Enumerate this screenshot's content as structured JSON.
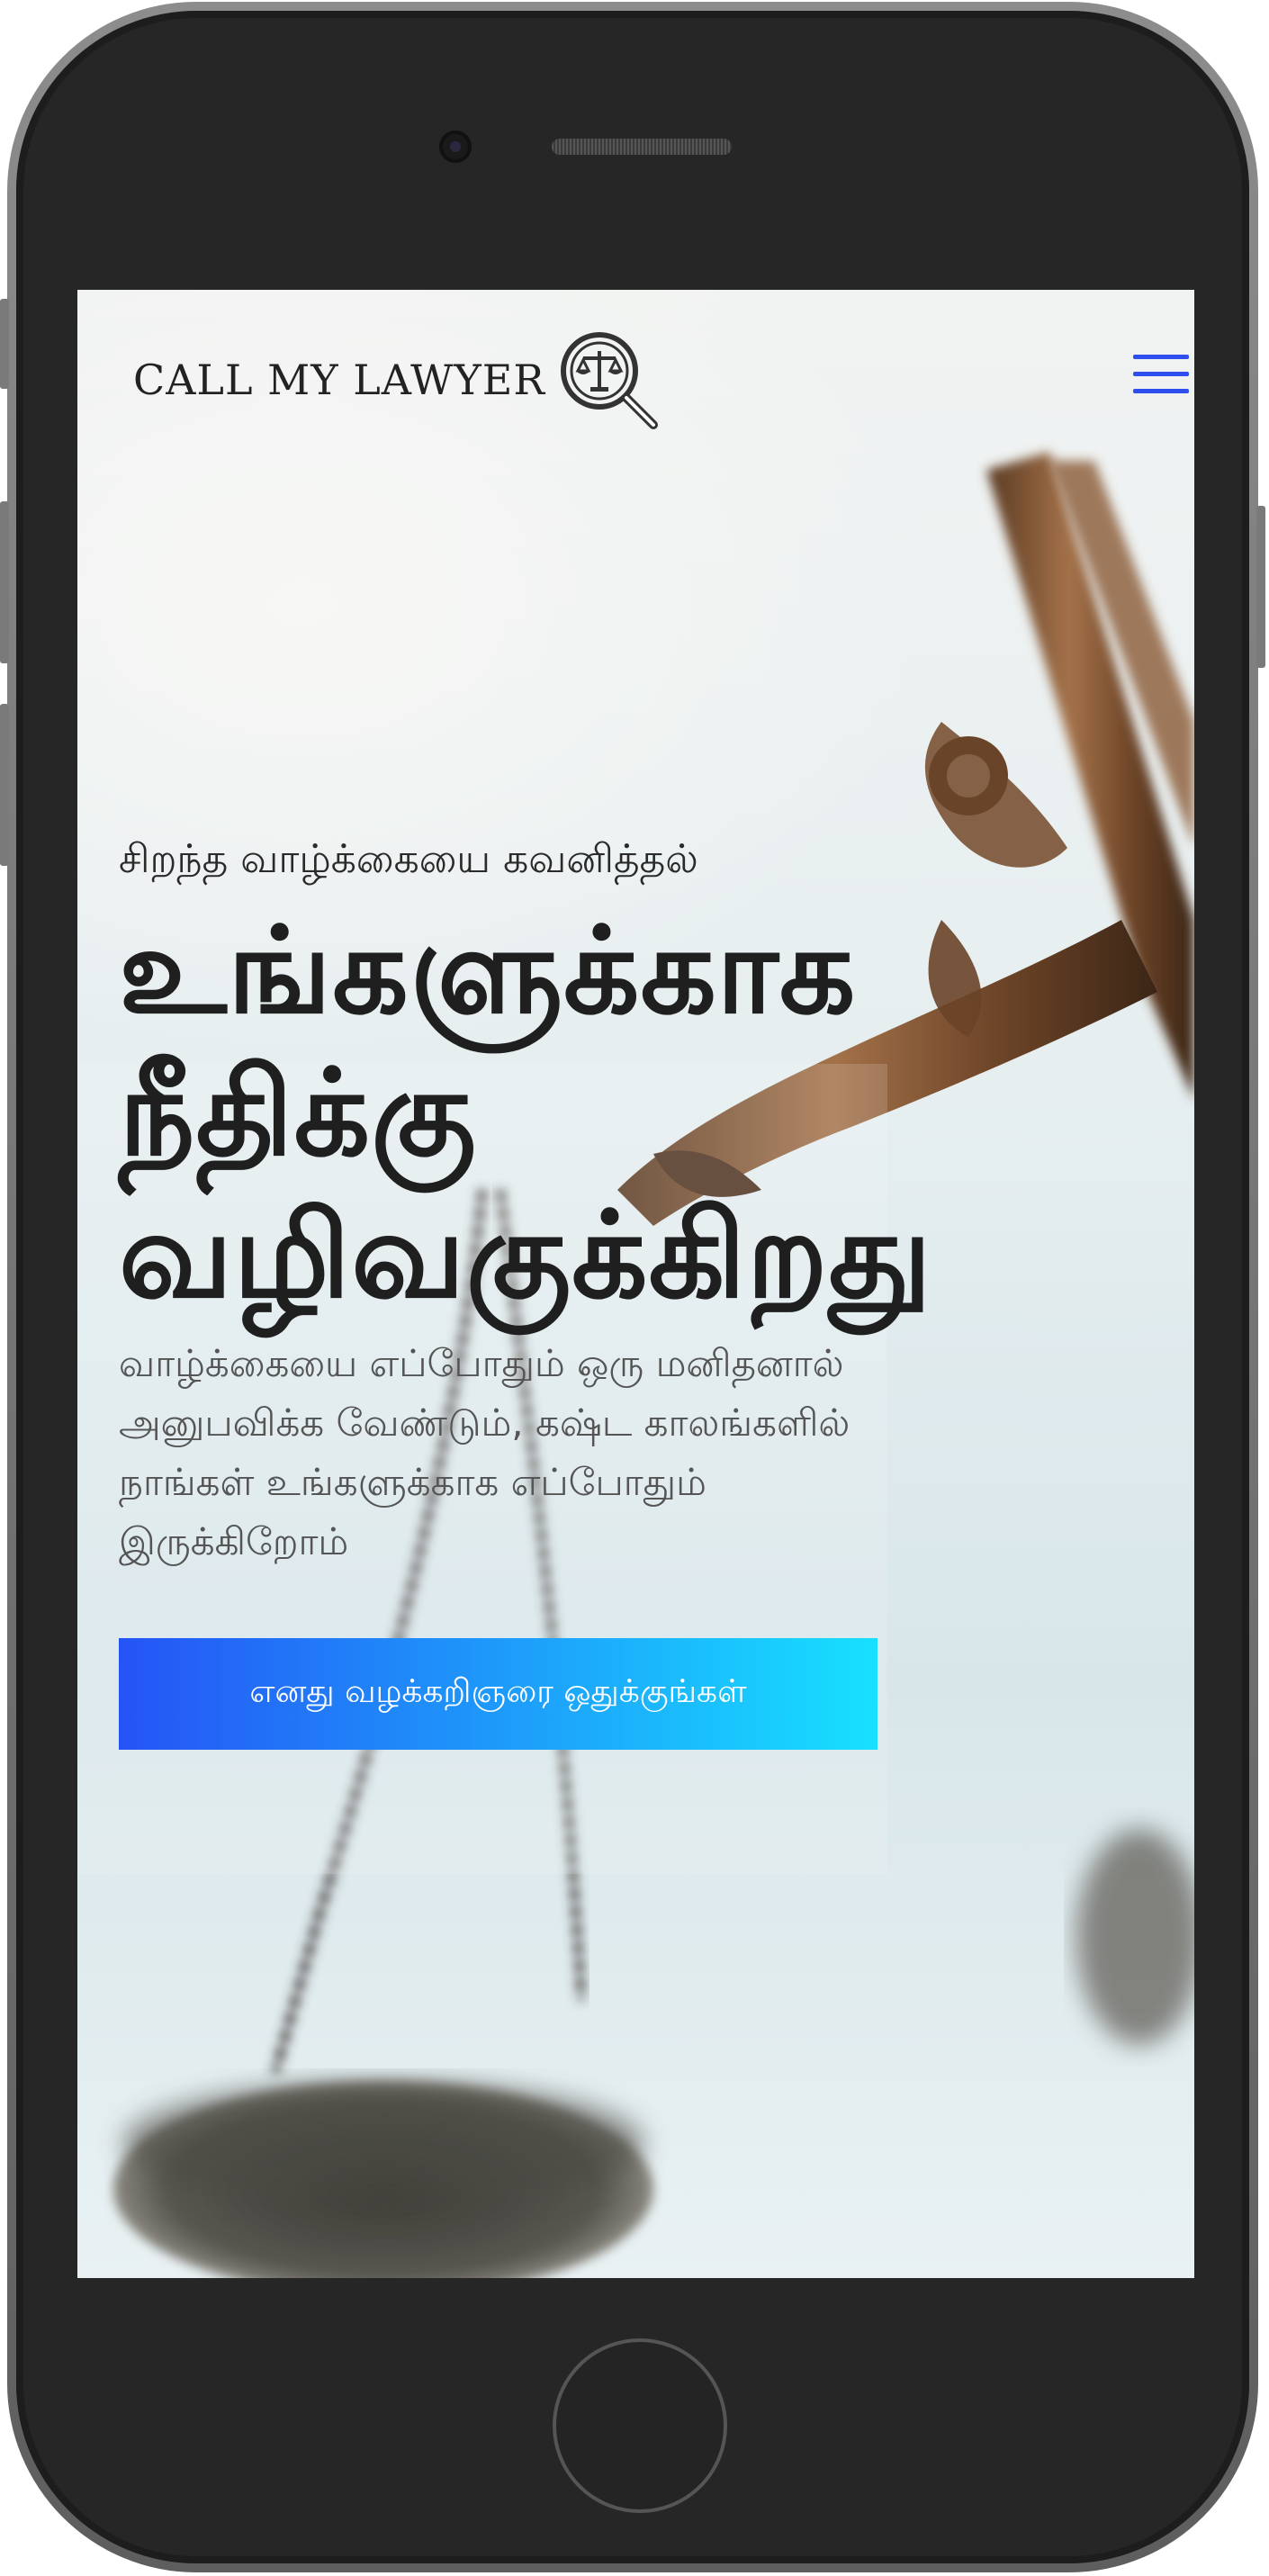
{
  "brand": {
    "name": "CALL MY LAWYER",
    "logo_icon": "scales-magnifier-icon",
    "accent_color": "#2e4ef0"
  },
  "nav": {
    "menu_icon": "hamburger-menu-icon"
  },
  "hero": {
    "eyebrow": "சிறந்த வாழ்க்கையை கவனித்தல்",
    "headline_lines": [
      "உங்களுக்காக",
      "நீதிக்கு",
      "வழிவகுக்கிறது"
    ],
    "subtext_lines": [
      "வாழ்க்கையை எப்போதும் ஒரு மனிதனால்",
      "அனுபவிக்க வேண்டும், கஷ்ட காலங்களில்",
      "நாங்கள் உங்களுக்காக எப்போதும்",
      "இருக்கிறோம்"
    ],
    "cta_label": "எனது வழக்கறிஞரை ஒதுக்குங்கள்",
    "cta_gradient": [
      "#2554f5",
      "#17e0ff"
    ]
  }
}
